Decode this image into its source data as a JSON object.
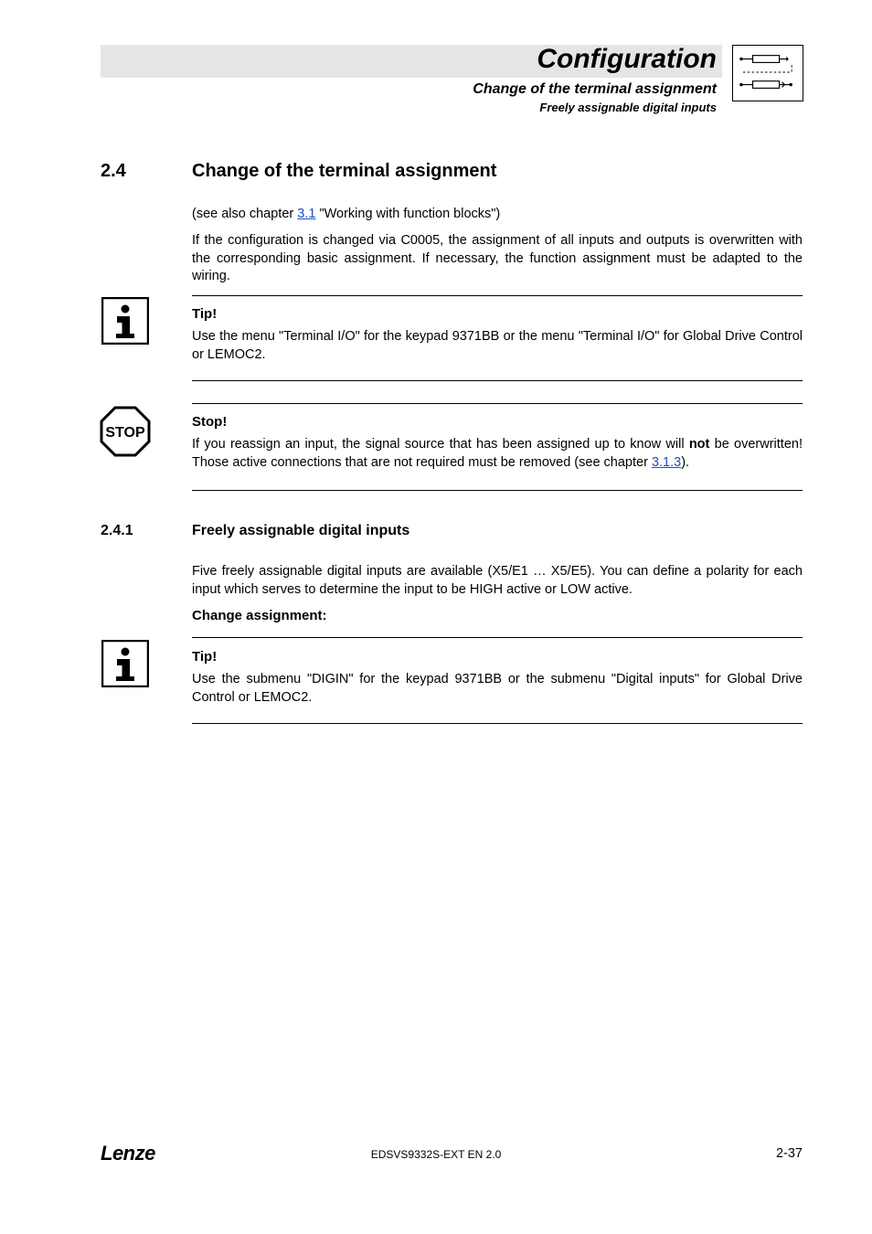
{
  "header": {
    "title": "Configuration",
    "subtitle1": "Change of the terminal assignment",
    "subtitle2": "Freely assignable digital inputs"
  },
  "section": {
    "number": "2.4",
    "title": "Change of the terminal assignment"
  },
  "intro": {
    "p1_pre": "(see also chapter ",
    "p1_link": "3.1",
    "p1_post": " \"Working with function blocks\")",
    "p2": "If the configuration is changed via C0005, the assignment of all inputs and outputs is overwritten with the corresponding basic assignment. If necessary, the function assignment must be adapted to the wiring."
  },
  "tip1": {
    "title": "Tip!",
    "body": "Use the menu \"Terminal I/O\" for the keypad 9371BB or the menu \"Terminal I/O\" for Global Drive Control or LEMOC2."
  },
  "stop": {
    "title": "Stop!",
    "line1_pre": "If you reassign an input, the signal source that has been assigned up to know will ",
    "line1_bold": "not",
    "line1_post": " be overwritten! Those active connections that are not required must be removed (see chapter ",
    "line1_link": "3.1.3",
    "line1_end": ")."
  },
  "subsection": {
    "number": "2.4.1",
    "title": "Freely assignable digital inputs",
    "p1": "Five freely assignable digital inputs are available (X5/E1 … X5/E5). You can define a polarity for each input which serves to determine the input to be HIGH active or LOW active.",
    "change_label": "Change assignment:"
  },
  "tip2": {
    "title": "Tip!",
    "body": "Use the submenu \"DIGIN\" for the keypad 9371BB or the submenu \"Digital inputs\" for Global Drive Control or LEMOC2."
  },
  "footer": {
    "logo": "Lenze",
    "center": "EDSVS9332S-EXT EN 2.0",
    "page": "2-37"
  },
  "icons": {
    "info": "info-icon",
    "stop": "stop-icon",
    "diagram": "block-diagram-icon"
  }
}
